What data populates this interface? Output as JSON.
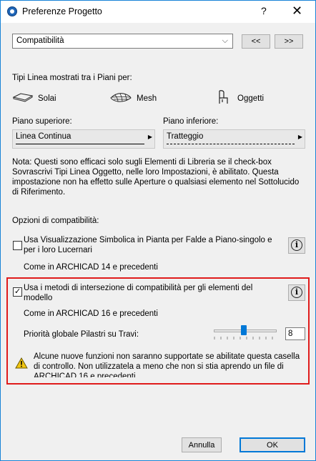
{
  "window": {
    "title": "Preferenze Progetto",
    "help_label": "?",
    "close_label": "✕"
  },
  "top": {
    "dropdown_value": "Compatibilità",
    "prev_label": "<<",
    "next_label": ">>"
  },
  "line_types": {
    "heading": "Tipi Linea mostrati tra i Piani per:",
    "options": [
      "Solai",
      "Mesh",
      "Oggetti"
    ]
  },
  "upper_floor": {
    "label": "Piano superiore:",
    "value": "Linea Continua"
  },
  "lower_floor": {
    "label": "Piano inferiore:",
    "value": "Tratteggio"
  },
  "note": "Nota: Questi sono efficaci solo sugli Elementi di Libreria se il check-box Sovrascrivi Tipi Linea Oggetto, nelle loro Impostazioni, è abilitato. Questa impostazione non ha effetto sulle Aperture o qualsiasi elemento nel Sottolucido di Riferimento.",
  "compat": {
    "heading": "Opzioni di compatibilità:",
    "option1_label": "Usa Visualizzazione Simbolica in Pianta per Falde a Piano-singolo e per i loro Lucernari",
    "option1_checked": false,
    "option1_note": "Come in ARCHICAD 14 e precedenti",
    "option2_label": "Usa i metodi di intersezione di compatibilità per gli elementi del modello",
    "option2_checked": true,
    "option2_note": "Come in ARCHICAD 16 e precedenti",
    "priority_label": "Priorità globale Pilastri su Travi:",
    "priority_value": "8",
    "warning": "Alcune nuove funzioni non saranno supportate se abilitate questa casella di controllo. Non utilizzatela a meno che non si stia aprendo un file di ARCHICAD 16 e precedenti"
  },
  "footer": {
    "cancel_label": "Annulla",
    "ok_label": "OK"
  },
  "colors": {
    "highlight_frame": "#e01b1b",
    "slider_thumb": "#0078d7",
    "ok_border": "#0078d7"
  }
}
